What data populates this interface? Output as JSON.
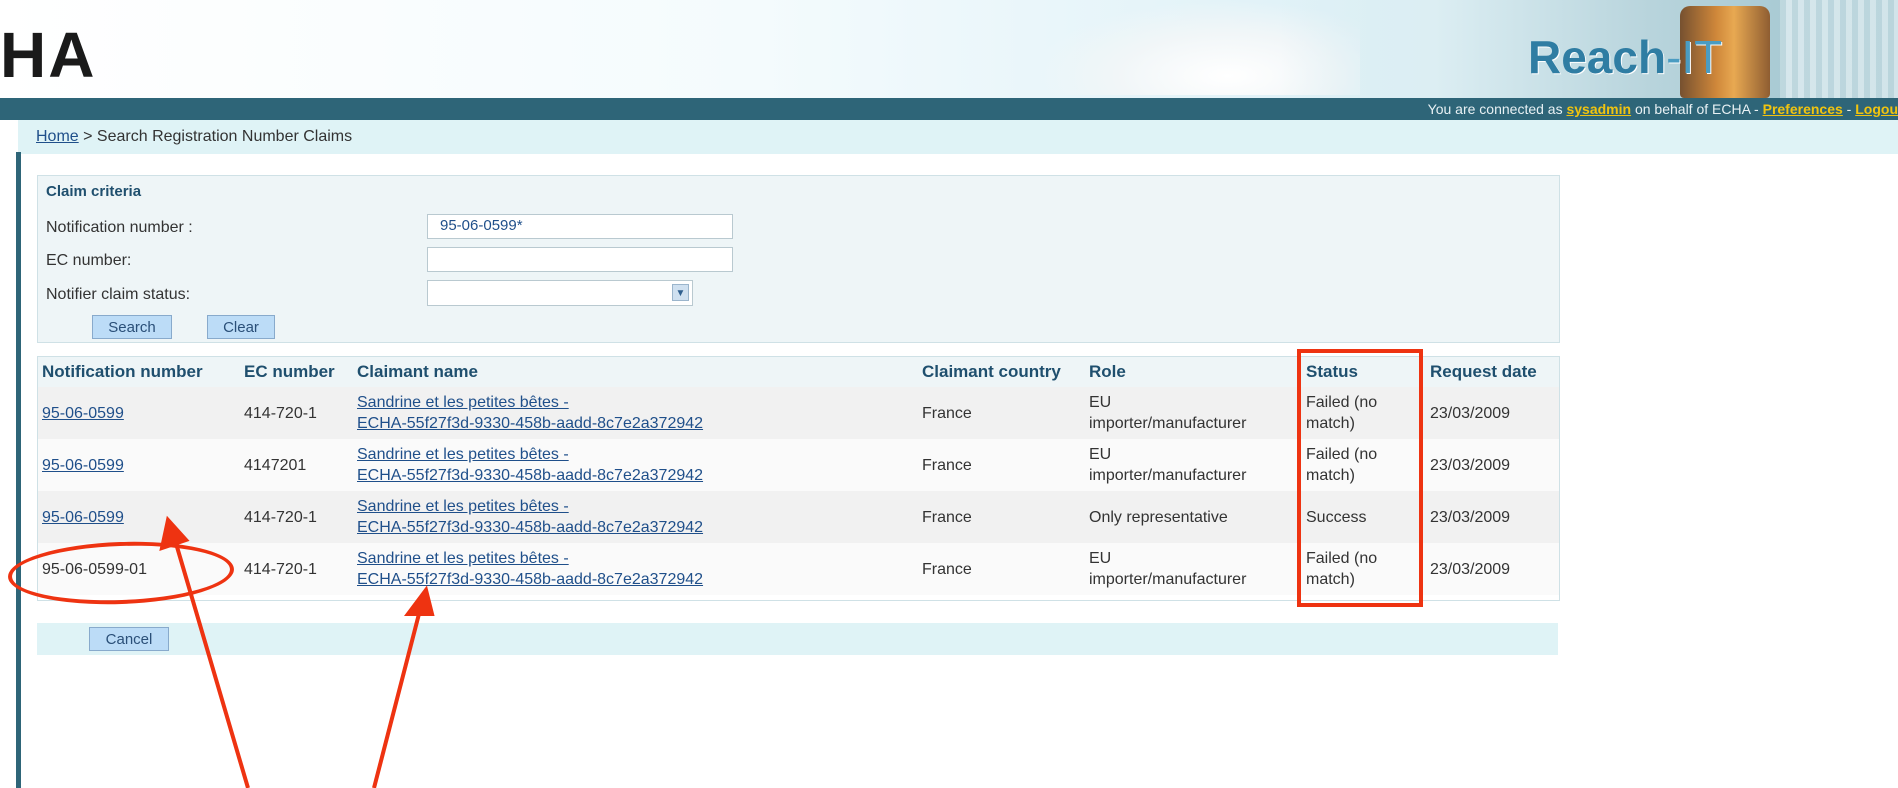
{
  "header": {
    "logo_text": "HA",
    "brand_main": "Reach",
    "brand_suffix": "-IT",
    "connected_prefix": "You are connected as ",
    "username": "sysadmin",
    "connected_middle": " on behalf of ECHA - ",
    "preferences_link": "Preferences",
    "separator": " - ",
    "logout_link": "Logou"
  },
  "breadcrumb": {
    "home": "Home",
    "separator": " > ",
    "current": "Search Registration Number Claims"
  },
  "criteria": {
    "title": "Claim criteria",
    "notification_label": "Notification number :",
    "notification_value": "95-06-0599*",
    "ec_label": "EC number:",
    "ec_value": "",
    "status_label": "Notifier claim status:",
    "status_value": "",
    "search_button": "Search",
    "clear_button": "Clear"
  },
  "results": {
    "columns": [
      "Notification number",
      "EC number",
      "Claimant name",
      "Claimant country",
      "Role",
      "Status",
      "Request date"
    ],
    "rows": [
      {
        "notification": "95-06-0599",
        "notification_link": true,
        "ec": "414-720-1",
        "claimant_line1": "Sandrine et les petites bêtes -",
        "claimant_line2": "ECHA-55f27f3d-9330-458b-aadd-8c7e2a372942",
        "country": "France",
        "role_line1": "EU",
        "role_line2": "importer/manufacturer",
        "status_line1": "Failed (no",
        "status_line2": "match)",
        "date": "23/03/2009"
      },
      {
        "notification": "95-06-0599",
        "notification_link": true,
        "ec": "4147201",
        "claimant_line1": "Sandrine et les petites bêtes -",
        "claimant_line2": "ECHA-55f27f3d-9330-458b-aadd-8c7e2a372942",
        "country": "France",
        "role_line1": "EU",
        "role_line2": "importer/manufacturer",
        "status_line1": "Failed (no",
        "status_line2": "match)",
        "date": "23/03/2009"
      },
      {
        "notification": "95-06-0599",
        "notification_link": true,
        "ec": "414-720-1",
        "claimant_line1": "Sandrine et les petites bêtes -",
        "claimant_line2": "ECHA-55f27f3d-9330-458b-aadd-8c7e2a372942",
        "country": "France",
        "role_line1": "Only representative",
        "role_line2": "",
        "status_line1": "Success",
        "status_line2": "",
        "date": "23/03/2009"
      },
      {
        "notification": "95-06-0599-01",
        "notification_link": false,
        "ec": "414-720-1",
        "claimant_line1": "Sandrine et les petites bêtes -",
        "claimant_line2": "ECHA-55f27f3d-9330-458b-aadd-8c7e2a372942",
        "country": "France",
        "role_line1": "EU",
        "role_line2": "importer/manufacturer",
        "status_line1": "Failed (no",
        "status_line2": "match)",
        "date": "23/03/2009"
      }
    ]
  },
  "footer": {
    "cancel_button": "Cancel"
  },
  "annotations": {
    "color": "#ee3311"
  }
}
